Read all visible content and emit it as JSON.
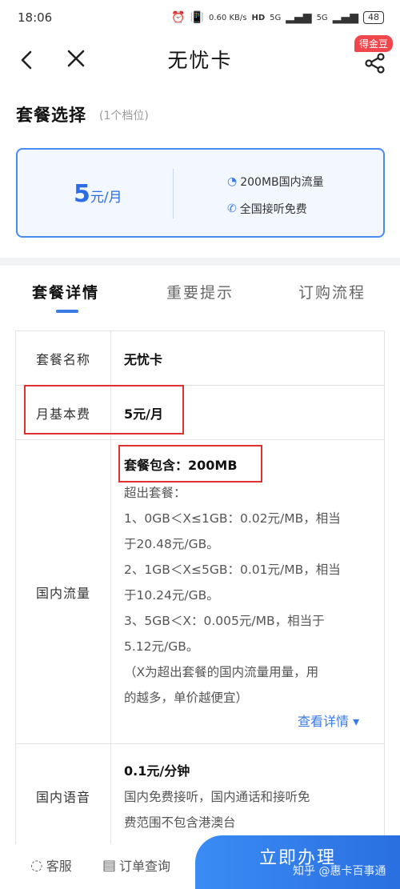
{
  "status_bar": {
    "time": "18:06",
    "net_speed": "0.60 KB/s",
    "signal_1": "5G",
    "signal_2": "5G",
    "hd_badge": "HD",
    "battery": "48"
  },
  "nav": {
    "title": "无忧卡",
    "badge": "得金豆",
    "back_icon": "chevron-left-icon",
    "close_icon": "close-icon",
    "share_icon": "share-icon"
  },
  "plan_section": {
    "title": "套餐选择",
    "subtitle": "(1个档位)",
    "card": {
      "price_num": "5",
      "price_unit": "元/月",
      "feature_1": "200MB国内流量",
      "feature_2": "全国接听免费"
    }
  },
  "tabs": [
    {
      "label": "套餐详情",
      "active": true
    },
    {
      "label": "重要提示",
      "active": false
    },
    {
      "label": "订购流程",
      "active": false
    }
  ],
  "details": {
    "name_label": "套餐名称",
    "name_value": "无忧卡",
    "fee_label": "月基本费",
    "fee_value": "5元/月",
    "data_label": "国内流量",
    "data_value": "套餐包含：200MB",
    "data_lines": [
      "超出套餐：",
      "1、0GB＜X≤1GB：0.02元/MB，相当",
      "于20.48元/GB。",
      "2、1GB＜X≤5GB：0.01元/MB，相当",
      "于10.24元/GB。",
      "3、5GB＜X：0.005元/MB，相当于",
      "5.12元/GB。",
      "（X为超出套餐的国内流量用量，用",
      "的越多，单价越便宜）"
    ],
    "more_link": "查看详情 ▾",
    "voice_label": "国内语音",
    "voice_value": "0.1元/分钟",
    "voice_lines": [
      "国内免费接听，国内通话和接听免",
      "费范围不包含港澳台"
    ]
  },
  "bottom_bar": {
    "service_label": "客服",
    "orders_label": "订单查询",
    "apply_label": "立即办理",
    "watermark": "知乎 @惠卡百事通"
  },
  "colors": {
    "accent": "#3b7be6",
    "highlight_box": "#e03131",
    "badge": "#f0474d"
  }
}
